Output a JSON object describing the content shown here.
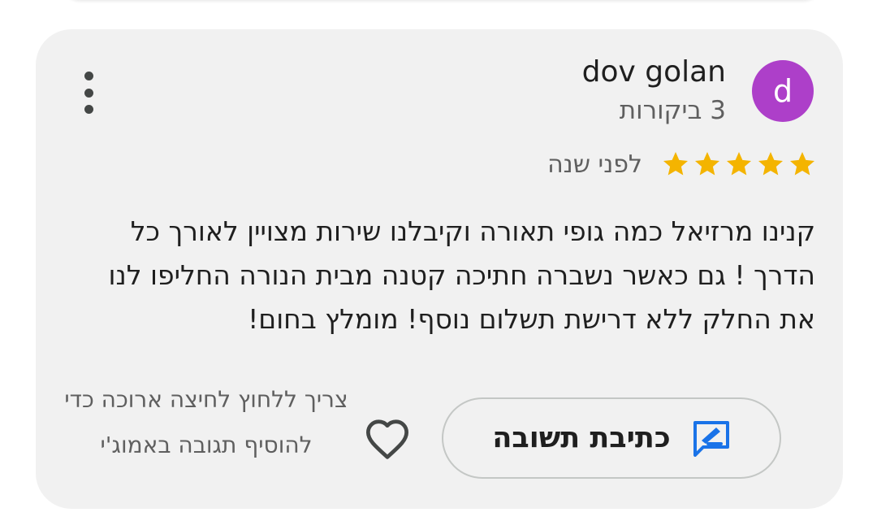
{
  "review": {
    "author": {
      "name": "dov golan",
      "avatar_letter": "d",
      "avatar_color": "#ad3fc9",
      "reviews_count": "3 ביקורות"
    },
    "rating": 5,
    "rating_max": 5,
    "star_color": "#f4b400",
    "date": "לפני שנה",
    "text": "קנינו מרזיאל כמה גופי תאורה וקיבלנו שירות מצויין לאורך כל הדרך ! גם כאשר נשברה חתיכה קטנה מבית הנורה החליפו לנו את החלק ללא דרישת תשלום נוסף! מומלץ בחום!"
  },
  "actions": {
    "reply_label": "כתיבת תשובה",
    "reply_icon": "edit-reply-icon",
    "like_icon": "heart-icon",
    "more_icon": "more-vert-icon",
    "accent_color": "#1a73e8"
  },
  "toast": {
    "message": "צריך ללחוץ לחיצה ארוכה כדי להוסיף תגובה באמוג'י"
  }
}
